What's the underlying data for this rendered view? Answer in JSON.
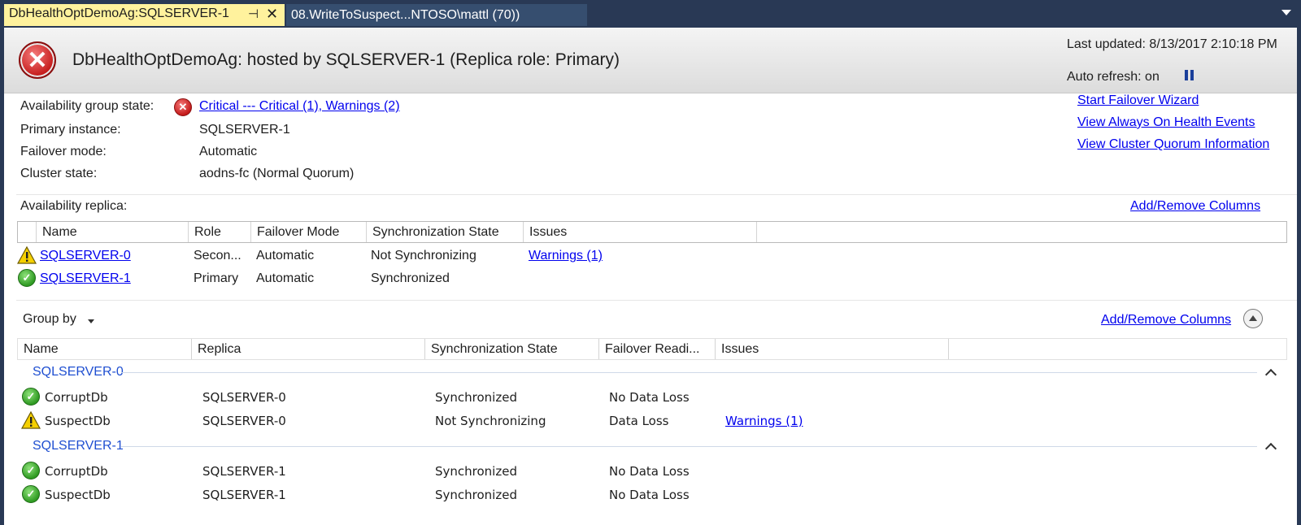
{
  "tabs": {
    "active_label": "DbHealthOptDemoAg:SQLSERVER-1",
    "inactive_label": "08.WriteToSuspect...NTOSO\\mattl (70))"
  },
  "header": {
    "title": "DbHealthOptDemoAg: hosted by SQLSERVER-1 (Replica role: Primary)",
    "last_updated": "Last updated: 8/13/2017 2:10:18 PM",
    "auto_refresh": "Auto refresh: on"
  },
  "summary": {
    "ag_state_label": "Availability group state:",
    "ag_state_value": "Critical --- Critical (1), Warnings (2)",
    "primary_label": "Primary instance:",
    "primary_value": "SQLSERVER-1",
    "failover_label": "Failover mode:",
    "failover_value": "Automatic",
    "cluster_label": "Cluster state:",
    "cluster_value": "aodns-fc (Normal Quorum)"
  },
  "links": {
    "start_failover": "Start Failover Wizard",
    "view_health": "View Always On Health Events",
    "view_quorum": "View Cluster Quorum Information"
  },
  "replicas": {
    "section_label": "Availability replica:",
    "add_remove": "Add/Remove Columns",
    "columns": [
      "Name",
      "Role",
      "Failover Mode",
      "Synchronization State",
      "Issues"
    ],
    "rows": [
      {
        "status": "warning",
        "name": "SQLSERVER-0",
        "role": "Secon...",
        "failover": "Automatic",
        "sync": "Not Synchronizing",
        "issues": "Warnings (1)"
      },
      {
        "status": "ok",
        "name": "SQLSERVER-1",
        "role": "Primary",
        "failover": "Automatic",
        "sync": "Synchronized",
        "issues": ""
      }
    ]
  },
  "databases": {
    "group_by": "Group by",
    "add_remove": "Add/Remove Columns",
    "columns": [
      "Name",
      "Replica",
      "Synchronization State",
      "Failover Readi...",
      "Issues"
    ],
    "groups": [
      {
        "name": "SQLSERVER-0",
        "rows": [
          {
            "status": "ok",
            "name": "CorruptDb",
            "replica": "SQLSERVER-0",
            "sync": "Synchronized",
            "readiness": "No Data Loss",
            "issues": ""
          },
          {
            "status": "warning",
            "name": "SuspectDb",
            "replica": "SQLSERVER-0",
            "sync": "Not Synchronizing",
            "readiness": "Data Loss",
            "issues": "Warnings (1)"
          }
        ]
      },
      {
        "name": "SQLSERVER-1",
        "rows": [
          {
            "status": "ok",
            "name": "CorruptDb",
            "replica": "SQLSERVER-1",
            "sync": "Synchronized",
            "readiness": "No Data Loss",
            "issues": ""
          },
          {
            "status": "ok",
            "name": "SuspectDb",
            "replica": "SQLSERVER-1",
            "sync": "Synchronized",
            "readiness": "No Data Loss",
            "issues": ""
          }
        ]
      }
    ]
  },
  "icons": {
    "pin": "pin-icon",
    "close": "close-icon",
    "error": "error-icon",
    "warning": "warning-icon",
    "ok": "ok-icon",
    "pause": "pause-icon",
    "collapse": "collapse-icon"
  }
}
